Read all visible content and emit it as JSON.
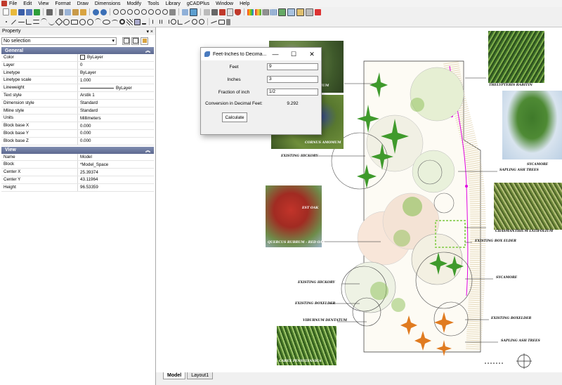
{
  "menu": [
    "File",
    "Edit",
    "View",
    "Format",
    "Draw",
    "Dimensions",
    "Modify",
    "Tools",
    "Library",
    "gCADPlus",
    "Window",
    "Help"
  ],
  "property_panel": {
    "title": "Property",
    "title_controls": "▾ ×",
    "selection": "No selection",
    "general_header": "General",
    "general": [
      {
        "k": "Color",
        "v": "ByLayer"
      },
      {
        "k": "Layer",
        "v": "0"
      },
      {
        "k": "Linetype",
        "v": "ByLayer"
      },
      {
        "k": "Linetype scale",
        "v": "1.000"
      },
      {
        "k": "Lineweight",
        "v": "ByLayer"
      },
      {
        "k": "Text style",
        "v": "Arstik 1"
      },
      {
        "k": "Dimension style",
        "v": "Standard"
      },
      {
        "k": "Mline style",
        "v": "Standard"
      },
      {
        "k": "Units",
        "v": "Millimeters"
      },
      {
        "k": "Block base X",
        "v": "0.000"
      },
      {
        "k": "Block base Y",
        "v": "0.000"
      },
      {
        "k": "Block base Z",
        "v": "0.000"
      }
    ],
    "view_header": "View",
    "view": [
      {
        "k": "Name",
        "v": "Model"
      },
      {
        "k": "Block",
        "v": "*Model_Space"
      },
      {
        "k": "Center X",
        "v": "25.39374"
      },
      {
        "k": "Center Y",
        "v": "43.11964"
      },
      {
        "k": "Height",
        "v": "96.53359"
      }
    ]
  },
  "dialog": {
    "title": "Feet-Inches to Decima...",
    "minimize": "—",
    "maximize": "☐",
    "close": "✕",
    "feet_label": "Feet",
    "feet_value": "9",
    "inches_label": "Inches",
    "inches_value": "3",
    "fraction_label": "Fraction of inch",
    "fraction_value": "1/2",
    "result_label": "Conversion in Decimal Feet:",
    "result_value": "9.292",
    "calculate": "Calculate"
  },
  "drawing": {
    "labels": {
      "thelypteris": "THELYPTERIS RABITIN",
      "sycamore1": "SYCAMORE",
      "sapling1": "SAPLING ASH TREES",
      "chasmanthium": "CHASMANTHIUM LATIFOLIUM",
      "box_elder": "EXISTING BOX ELDER",
      "sycamore2": "SYCAMORE",
      "boxelder2": "EXISTING BOXELDER",
      "sapling2": "SAPLING ASH TREES",
      "hickory1": "EXISTING HICKORY",
      "hickory2": "EXISTING HICKORY",
      "boxelder3": "EXISTING BOXELDER",
      "viburnum": "VIBURNUM DENTATUM"
    },
    "photo_labels": {
      "photo1": "DIUM",
      "photo2": "CORNUS AMOMUM",
      "photo3a": "EST OAK",
      "photo3b": "QUERCUS RUBRUM - RED OAK",
      "photo4": "CAREX PENSYLVANICA"
    }
  },
  "tabs": [
    "Model",
    "Layout1"
  ],
  "colors": {
    "accent": "#5d6990",
    "magenta": "#e000e0",
    "dialog_bg": "#f0f0f0"
  },
  "icons": [
    "new-icon",
    "open-icon",
    "save-icon",
    "print-icon",
    "cut-icon",
    "copy-icon",
    "paste-icon",
    "undo-icon",
    "redo-icon",
    "zoom-icon",
    "pan-icon",
    "line-icon",
    "circle-icon",
    "arc-icon",
    "rectangle-icon",
    "polyline-icon",
    "text-icon",
    "hatch-icon",
    "dimension-icon",
    "layer-icon"
  ]
}
